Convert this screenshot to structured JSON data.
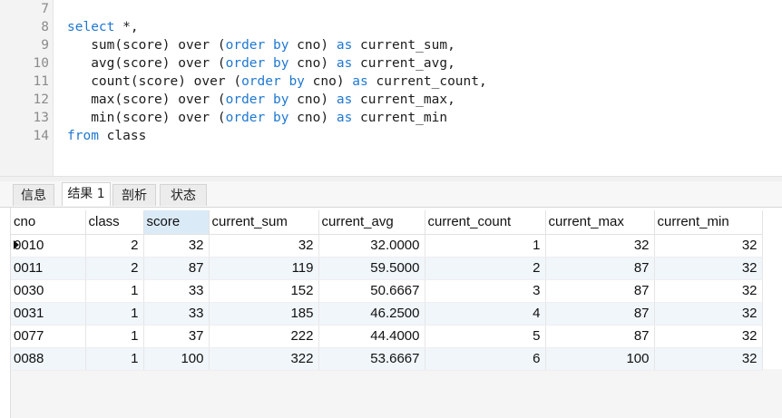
{
  "editor": {
    "lines": [
      {
        "num": "7",
        "tokens": []
      },
      {
        "num": "8",
        "tokens": [
          {
            "t": "select",
            "k": true
          },
          {
            "t": " *,",
            "k": false
          }
        ]
      },
      {
        "num": "9",
        "tokens": [
          {
            "t": "   sum(score) over (",
            "k": false
          },
          {
            "t": "order by",
            "k": true
          },
          {
            "t": " cno) ",
            "k": false
          },
          {
            "t": "as",
            "k": true
          },
          {
            "t": " current_sum,",
            "k": false
          }
        ]
      },
      {
        "num": "10",
        "tokens": [
          {
            "t": "   avg(score) over (",
            "k": false
          },
          {
            "t": "order by",
            "k": true
          },
          {
            "t": " cno) ",
            "k": false
          },
          {
            "t": "as",
            "k": true
          },
          {
            "t": " current_avg,",
            "k": false
          }
        ]
      },
      {
        "num": "11",
        "tokens": [
          {
            "t": "   count(score) over (",
            "k": false
          },
          {
            "t": "order by",
            "k": true
          },
          {
            "t": " cno) ",
            "k": false
          },
          {
            "t": "as",
            "k": true
          },
          {
            "t": " current_count,",
            "k": false
          }
        ]
      },
      {
        "num": "12",
        "tokens": [
          {
            "t": "   max(score) over (",
            "k": false
          },
          {
            "t": "order by",
            "k": true
          },
          {
            "t": " cno) ",
            "k": false
          },
          {
            "t": "as",
            "k": true
          },
          {
            "t": " current_max,",
            "k": false
          }
        ]
      },
      {
        "num": "13",
        "tokens": [
          {
            "t": "   min(score) over (",
            "k": false
          },
          {
            "t": "order by",
            "k": true
          },
          {
            "t": " cno) ",
            "k": false
          },
          {
            "t": "as",
            "k": true
          },
          {
            "t": " current_min",
            "k": false
          }
        ]
      },
      {
        "num": "14",
        "tokens": [
          {
            "t": "from",
            "k": true
          },
          {
            "t": " class",
            "k": false
          }
        ]
      }
    ]
  },
  "tabs": [
    {
      "label": "信息",
      "active": false
    },
    {
      "label": "结果 1",
      "active": true
    },
    {
      "label": "剖析",
      "active": false
    },
    {
      "label": "状态",
      "active": false
    }
  ],
  "results": {
    "columns": [
      "cno",
      "class",
      "score",
      "current_sum",
      "current_avg",
      "current_count",
      "current_max",
      "current_min"
    ],
    "sorted_column": "score",
    "rows": [
      [
        "0010",
        "2",
        "32",
        "32",
        "32.0000",
        "1",
        "32",
        "32"
      ],
      [
        "0011",
        "2",
        "87",
        "119",
        "59.5000",
        "2",
        "87",
        "32"
      ],
      [
        "0030",
        "1",
        "33",
        "152",
        "50.6667",
        "3",
        "87",
        "32"
      ],
      [
        "0031",
        "1",
        "33",
        "185",
        "46.2500",
        "4",
        "87",
        "32"
      ],
      [
        "0077",
        "1",
        "37",
        "222",
        "44.4000",
        "5",
        "87",
        "32"
      ],
      [
        "0088",
        "1",
        "100",
        "322",
        "53.6667",
        "6",
        "100",
        "32"
      ]
    ]
  },
  "colors": {
    "keyword": "#1f78d1",
    "sorted_header": "#dbeaf7",
    "alt_row": "#f1f6fb"
  },
  "icons": {
    "current_row": "row-indicator-icon"
  }
}
